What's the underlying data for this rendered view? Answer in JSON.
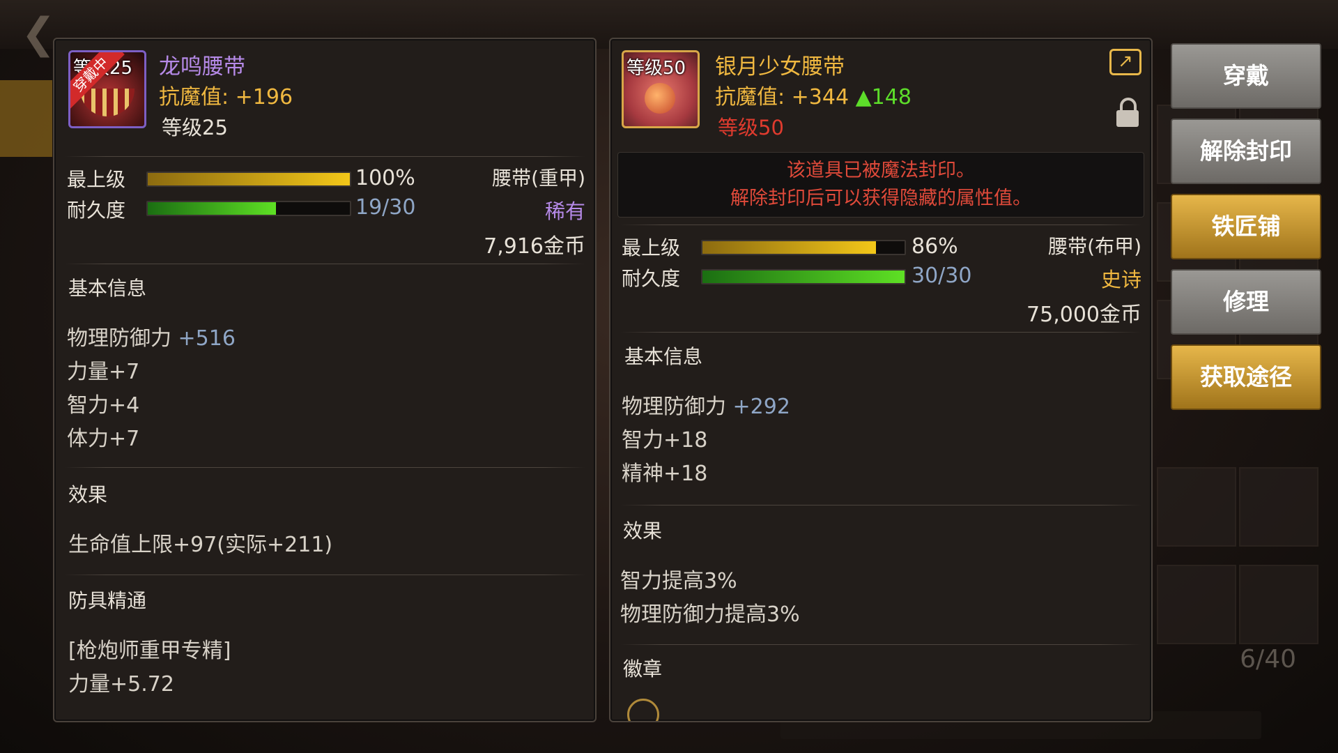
{
  "colors": {
    "rare_purple": "#b68ae8",
    "epic_gold": "#f0b840",
    "magic_def_gold": "#f0b840",
    "increase_green": "#5ddd2a",
    "warning_red": "#e03b2e",
    "stat_blue": "#8fa6c6"
  },
  "left_item": {
    "icon_level": "等级25",
    "equipped_badge": "穿戴中",
    "name": "龙鸣腰带",
    "magic_def": "抗魔值: +196",
    "level": "等级25",
    "grade_label": "最上级",
    "grade_value": "100%",
    "grade_fraction": 1.0,
    "durability_label": "耐久度",
    "durability_value": "19/30",
    "durability_fraction": 0.633,
    "type": "腰带(重甲)",
    "rarity": "稀有",
    "price": "7,916金币",
    "basic_title": "基本信息",
    "basic_stats": [
      {
        "name": "物理防御力 ",
        "plus": "+516"
      },
      {
        "name": "力量+7",
        "plus": ""
      },
      {
        "name": "智力+4",
        "plus": ""
      },
      {
        "name": "体力+7",
        "plus": ""
      }
    ],
    "effect_title": "效果",
    "effects": [
      "生命值上限+97(实际+211)"
    ],
    "mastery_title": "防具精通",
    "mastery_lines": [
      "[枪炮师重甲专精]",
      "力量+5.72"
    ]
  },
  "right_item": {
    "icon_level": "等级50",
    "name": "银月少女腰带",
    "magic_def": "抗魔值: +344 ",
    "magic_def_increase": "▲148",
    "level": "等级50",
    "seal_line1": "该道具已被魔法封印。",
    "seal_line2": "解除封印后可以获得隐藏的属性值。",
    "grade_label": "最上级",
    "grade_value": "86%",
    "grade_fraction": 0.86,
    "durability_label": "耐久度",
    "durability_value": "30/30",
    "durability_fraction": 1.0,
    "type": "腰带(布甲)",
    "rarity": "史诗",
    "price": "75,000金币",
    "basic_title": "基本信息",
    "basic_stats": [
      {
        "name": "物理防御力 ",
        "plus": "+292"
      },
      {
        "name": "智力+18",
        "plus": ""
      },
      {
        "name": "精神+18",
        "plus": ""
      }
    ],
    "effect_title": "效果",
    "effects": [
      "智力提高3%",
      "物理防御力提高3%"
    ],
    "emblem_title": "徽章"
  },
  "buttons": {
    "equip": "穿戴",
    "unseal": "解除封印",
    "blacksmith": "铁匠铺",
    "repair": "修理",
    "obtain": "获取途径"
  },
  "background": {
    "inventory_count": "6/40"
  }
}
